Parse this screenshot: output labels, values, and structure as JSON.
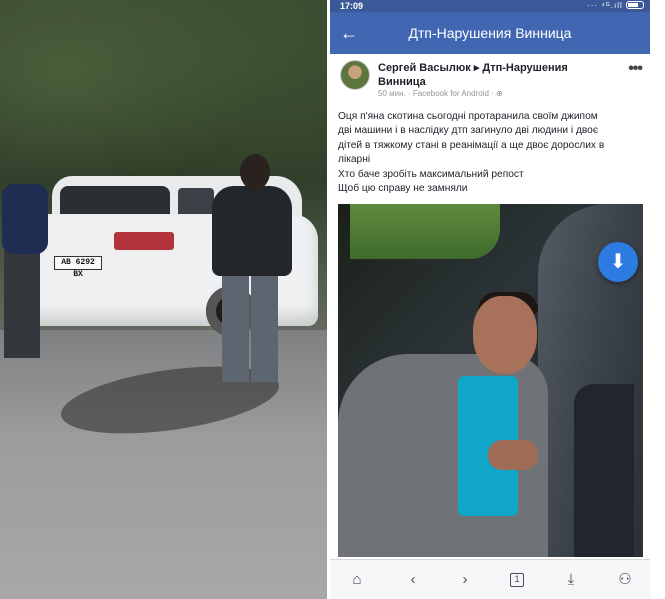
{
  "status_bar": {
    "time": "17:09",
    "icons": "··· ⁴ᴳ.ıll"
  },
  "app_bar": {
    "title": "Дтп-Нарушения Винница",
    "back_icon": "←"
  },
  "post": {
    "author_line": "Сергей Васылюк ▸ Дтп-Нарушения Винница",
    "meta": "50 мин. · Facebook for Android · ⊕",
    "more_icon": "•••",
    "text_lines": [
      "Оця п'яна скотина сьогодні протаранила своїм джипом",
      "дві машини і в наслідку дтп загинуло дві людини і двоє",
      "дітей в тяжкому стані в реанімації а ще двоє дорослих в",
      "лікарні",
      "Хто баче зробіть максимальний репост",
      "Щоб цю справу не замняли"
    ],
    "fab_icon": "⬇"
  },
  "left_photo": {
    "plate_text": "АВ 6292 ВХ"
  },
  "nav_bar": {
    "home_icon": "⌂",
    "back_icon": "‹",
    "forward_icon": "›",
    "tabs_count": "1",
    "download_icon": "⤓",
    "account_icon": "⚇"
  }
}
